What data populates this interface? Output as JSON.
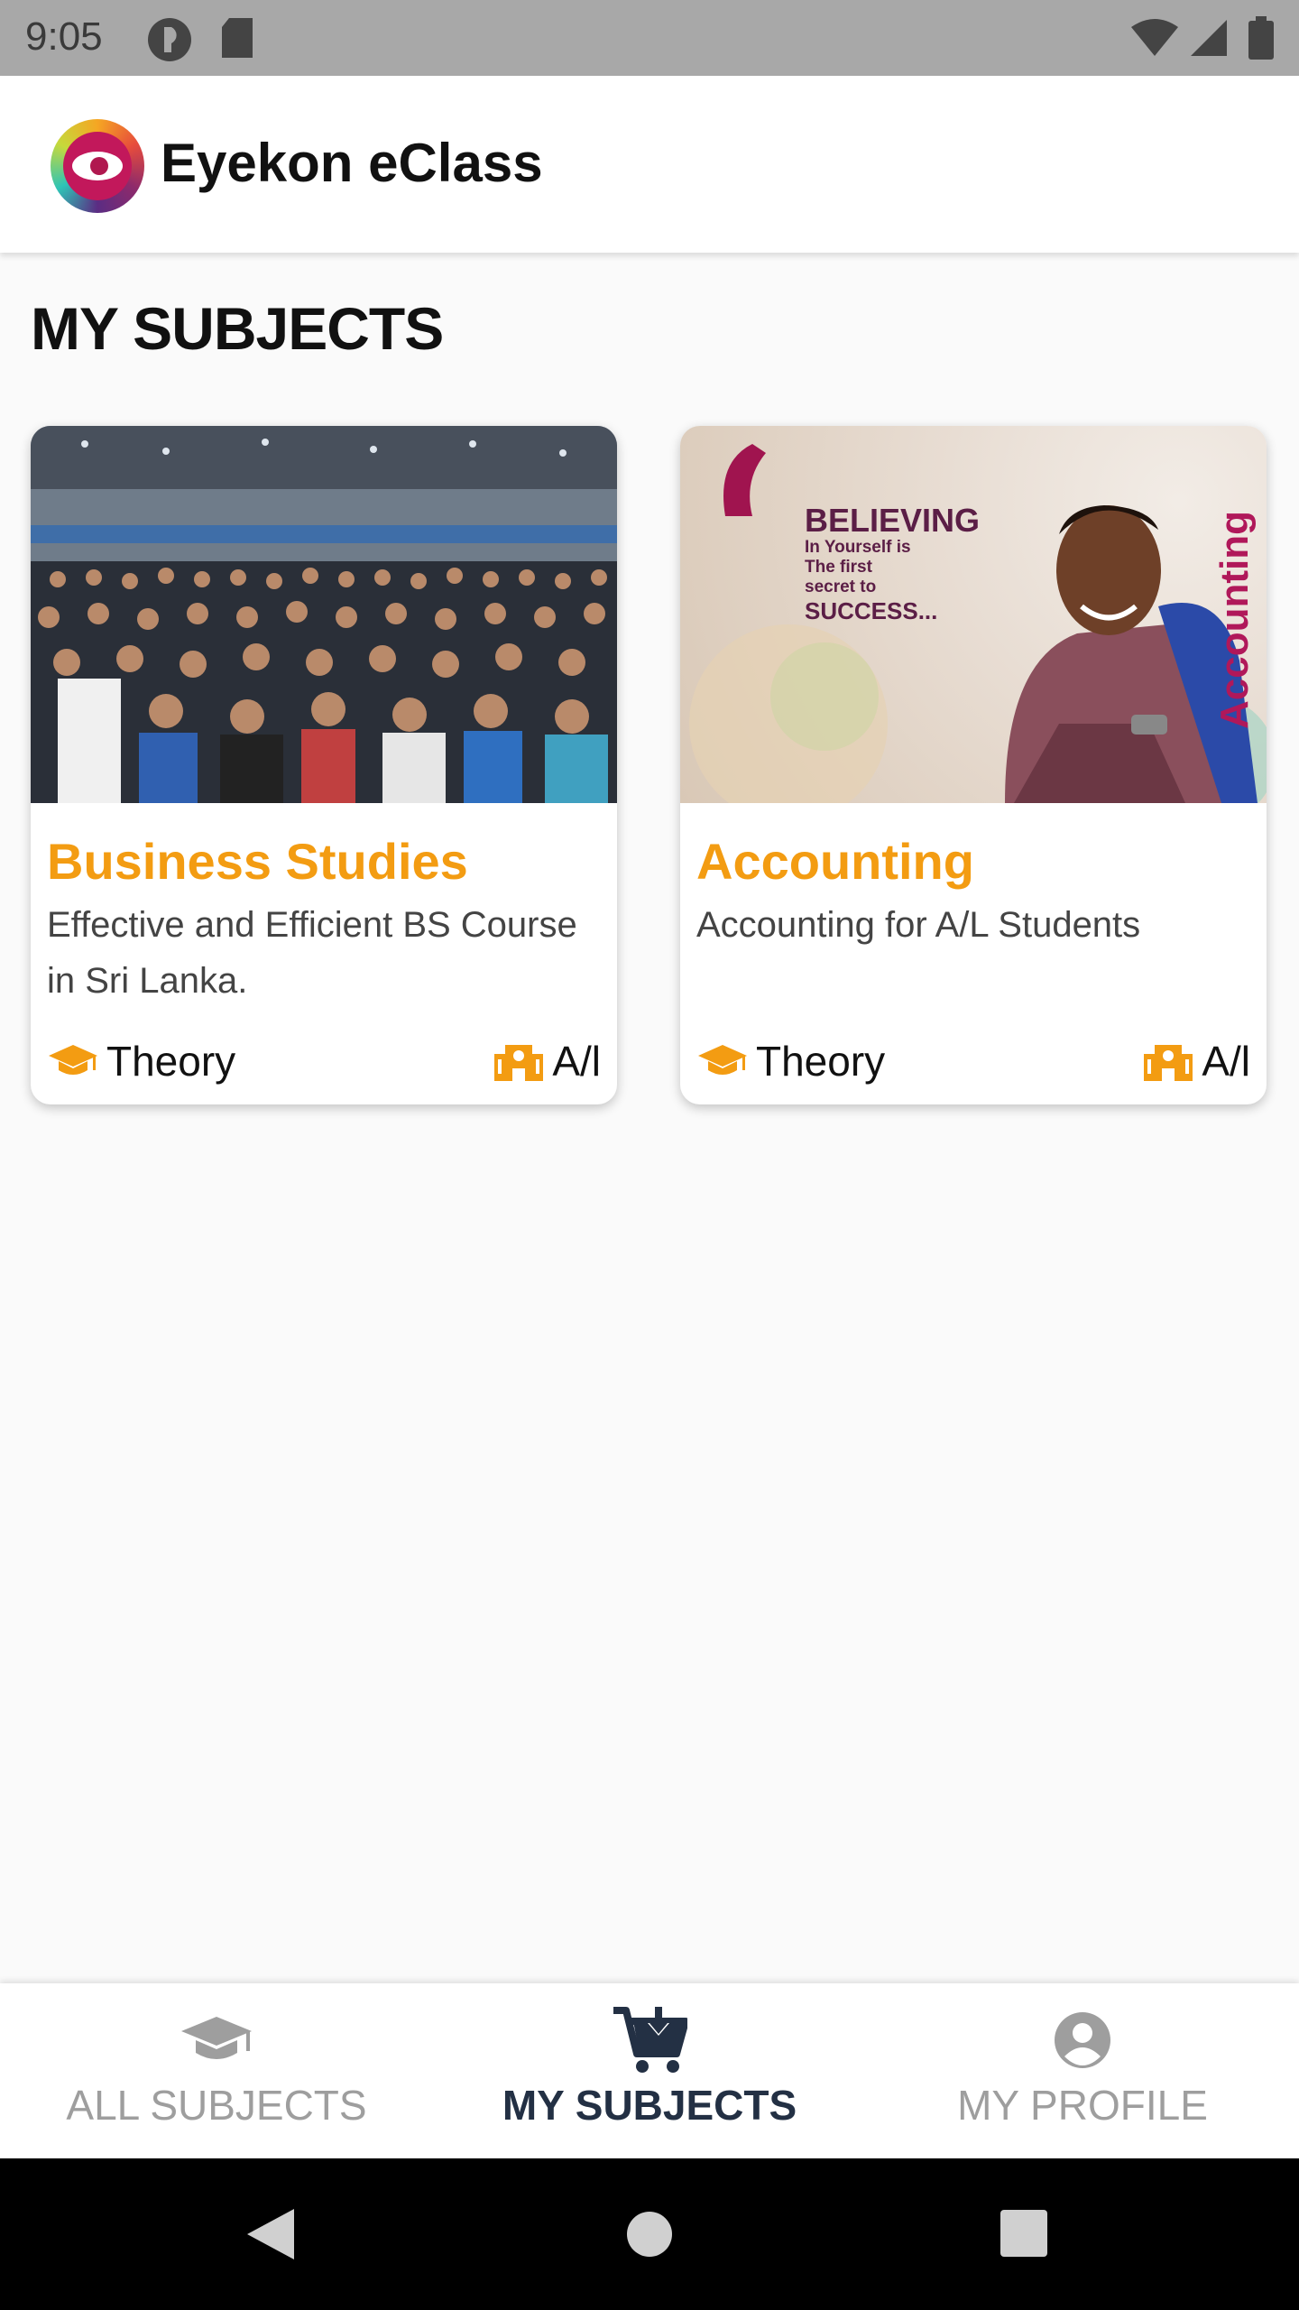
{
  "status_bar": {
    "time": "9:05"
  },
  "app": {
    "title": "Eyekon eClass"
  },
  "page": {
    "section_title": "MY SUBJECTS"
  },
  "subjects": [
    {
      "title": "Business Studies",
      "description": "Effective and Efficient BS Course in Sri Lanka.",
      "type": "Theory",
      "level": "A/l"
    },
    {
      "title": "Accounting",
      "description": "Accounting for A/L Students",
      "type": "Theory",
      "level": "A/l",
      "image_text": {
        "headline": "BELIEVING",
        "line1": "In Yourself is",
        "line2": "The first",
        "line3": "secret to",
        "line4": "SUCCESS...",
        "side": "Accounting"
      }
    }
  ],
  "bottom_nav": {
    "items": [
      {
        "label": "ALL SUBJECTS",
        "icon": "graduation-cap-icon",
        "active": false
      },
      {
        "label": "MY SUBJECTS",
        "icon": "cart-download-icon",
        "active": true
      },
      {
        "label": "MY PROFILE",
        "icon": "account-circle-icon",
        "active": false
      }
    ]
  },
  "colors": {
    "accent": "#f39c12",
    "active_nav": "#233044",
    "inactive_nav": "#9e9e9e",
    "status_bar": "#a8a8a8"
  }
}
